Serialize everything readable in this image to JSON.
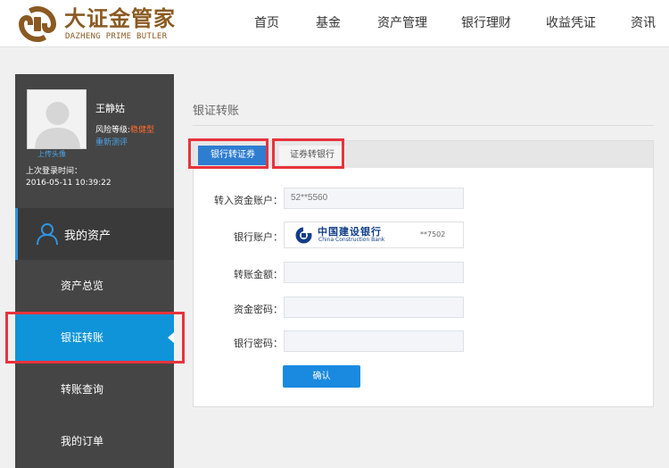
{
  "brand": {
    "name_cn": "大证金管家",
    "name_en": "DAZHENG PRIME BUTLER",
    "logo_icon": "dazheng-logo-icon",
    "color": "#8a5a22"
  },
  "nav": {
    "items": [
      "首页",
      "基金",
      "资产管理",
      "银行理财",
      "收益凭证",
      "资讯"
    ]
  },
  "profile": {
    "upload_avatar": "上传头像",
    "name": "王静姑",
    "risk_label": "风险等级:",
    "risk_value": "稳健型",
    "reassess": "重新测评",
    "last_login_label": "上次登录时间：",
    "last_login_time": "2016-05-11 10:39:22"
  },
  "sidebar": {
    "section_label": "我的资产",
    "section_icon": "user-icon",
    "items": [
      {
        "label": "资产总览",
        "active": false
      },
      {
        "label": "银证转账",
        "active": true
      },
      {
        "label": "转账查询",
        "active": false
      },
      {
        "label": "我的订单",
        "active": false
      }
    ]
  },
  "main": {
    "page_title": "银证转账",
    "tabs": [
      {
        "label": "银行转证券",
        "active": true
      },
      {
        "label": "证券转银行",
        "active": false
      }
    ],
    "form": {
      "account_label": "转入资金账户：",
      "account_value": "52**5560",
      "bank_label": "银行账户：",
      "bank_name_cn": "中国建设银行",
      "bank_name_en": "China Construction Bank",
      "bank_icon": "ccb-logo-icon",
      "bank_tail": "**7502",
      "amount_label": "转账金额：",
      "fund_pwd_label": "资金密码：",
      "bank_pwd_label": "银行密码：",
      "confirm": "确认"
    }
  },
  "colors": {
    "accent": "#1a8ae0",
    "sidebar_bg": "#454545",
    "active_menu": "#0f94d9",
    "highlight_box": "#e8333c",
    "risk_value": "#ff6a2a"
  }
}
